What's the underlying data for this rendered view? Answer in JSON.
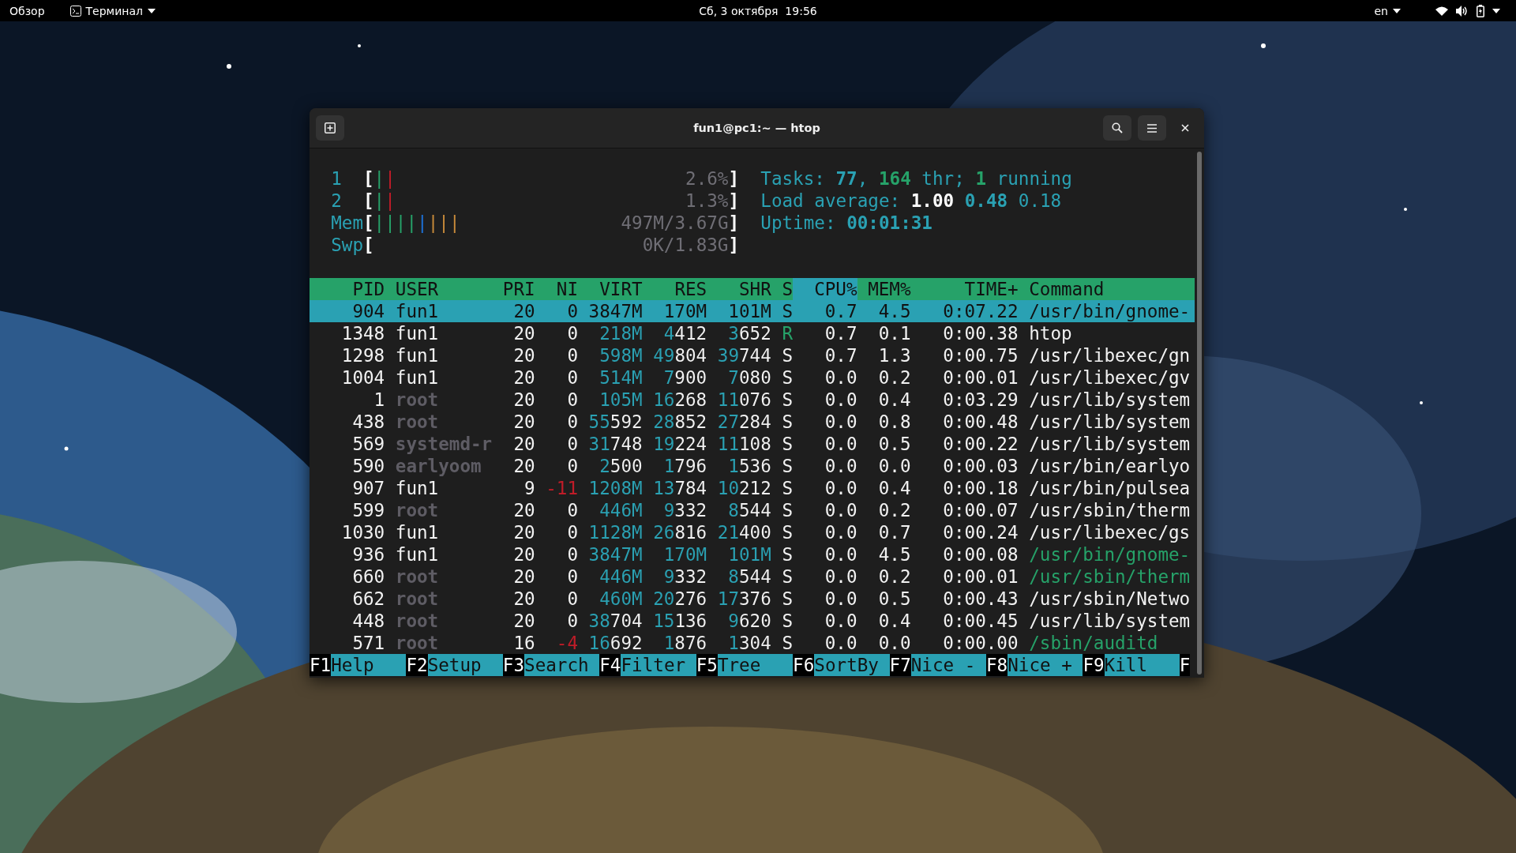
{
  "top_bar": {
    "activities": "Обзор",
    "app_menu": "Терминал",
    "clock": "Сб, 3 октября  19:56",
    "keyboard_layout": "en"
  },
  "window": {
    "title": "fun1@pc1:~ — htop"
  },
  "meters": [
    {
      "label": "1",
      "open": "[",
      "segments": [
        {
          "text": "|",
          "color": "#26a269"
        },
        {
          "text": "|",
          "color": "#c01c28"
        }
      ],
      "value": "2.6%",
      "close": "]"
    },
    {
      "label": "2",
      "open": "[",
      "segments": [
        {
          "text": "|",
          "color": "#26a269"
        },
        {
          "text": "|",
          "color": "#c01c28"
        }
      ],
      "value": "1.3%",
      "close": "]"
    },
    {
      "label": "Mem",
      "open": "[",
      "segments": [
        {
          "text": "|",
          "color": "#26a269"
        },
        {
          "text": "|",
          "color": "#26a269"
        },
        {
          "text": "|",
          "color": "#26a269"
        },
        {
          "text": "|",
          "color": "#26a269"
        },
        {
          "text": "|",
          "color": "#1c71d8"
        },
        {
          "text": "|",
          "color": "#c88a3a"
        },
        {
          "text": "|",
          "color": "#c88a3a"
        },
        {
          "text": "|",
          "color": "#c88a3a"
        }
      ],
      "value": "497M/3.67G",
      "close": "]"
    },
    {
      "label": "Swp",
      "open": "[",
      "value": "0K/1.83G",
      "close": "]"
    }
  ],
  "summary": [
    {
      "parts": [
        {
          "text": "Tasks: ",
          "kind": "label"
        },
        {
          "text": "77",
          "kind": "primary"
        },
        {
          "text": ", ",
          "kind": "label"
        },
        {
          "text": "164",
          "kind": "secondary"
        },
        {
          "text": " thr; ",
          "kind": "label"
        },
        {
          "text": "1",
          "kind": "secondary"
        },
        {
          "text": " running",
          "kind": "label"
        }
      ]
    },
    {
      "parts": [
        {
          "text": "Load average: ",
          "kind": "label"
        },
        {
          "text": "1.00",
          "kind": "accent"
        },
        {
          "text": " 0.48",
          "kind": "primary"
        },
        {
          "text": " 0.18",
          "kind": "label"
        }
      ]
    },
    {
      "parts": [
        {
          "text": "Uptime: ",
          "kind": "label"
        },
        {
          "text": "00:01:31",
          "kind": "primary"
        }
      ]
    }
  ],
  "columns": [
    {
      "label": "PID",
      "selected": false
    },
    {
      "label": "USER",
      "selected": false
    },
    {
      "label": "PRI",
      "selected": false
    },
    {
      "label": "NI",
      "selected": false
    },
    {
      "label": "VIRT",
      "selected": false
    },
    {
      "label": "RES",
      "selected": false
    },
    {
      "label": "SHR",
      "selected": false
    },
    {
      "label": "S",
      "selected": false
    },
    {
      "label": "CPU%",
      "selected": true
    },
    {
      "label": "MEM%",
      "selected": false
    },
    {
      "label": "TIME+",
      "selected": false
    },
    {
      "label": "Command",
      "selected": false
    }
  ],
  "rows": [
    {
      "pid": "904",
      "user": "fun1",
      "pri": "20",
      "ni": "0",
      "virt": "3847M",
      "res": "170M",
      "shr": "101M",
      "state": "S",
      "cpu": "0.7",
      "mem": "4.5",
      "time": "0:07.22",
      "command": "/usr/bin/gnome-",
      "selected": true,
      "system_user": false,
      "running": false,
      "thread": false
    },
    {
      "pid": "1348",
      "user": "fun1",
      "pri": "20",
      "ni": "0",
      "virt": "218M",
      "res": "4412",
      "shr": "3652",
      "state": "R",
      "cpu": "0.7",
      "mem": "0.1",
      "time": "0:00.38",
      "command": "htop",
      "selected": false,
      "system_user": false,
      "running": true,
      "thread": false
    },
    {
      "pid": "1298",
      "user": "fun1",
      "pri": "20",
      "ni": "0",
      "virt": "598M",
      "res": "49804",
      "shr": "39744",
      "state": "S",
      "cpu": "0.7",
      "mem": "1.3",
      "time": "0:00.75",
      "command": "/usr/libexec/gn",
      "selected": false,
      "system_user": false,
      "running": false,
      "thread": false
    },
    {
      "pid": "1004",
      "user": "fun1",
      "pri": "20",
      "ni": "0",
      "virt": "514M",
      "res": "7900",
      "shr": "7080",
      "state": "S",
      "cpu": "0.0",
      "mem": "0.2",
      "time": "0:00.01",
      "command": "/usr/libexec/gv",
      "selected": false,
      "system_user": false,
      "running": false,
      "thread": false
    },
    {
      "pid": "1",
      "user": "root",
      "pri": "20",
      "ni": "0",
      "virt": "105M",
      "res": "16268",
      "shr": "11076",
      "state": "S",
      "cpu": "0.0",
      "mem": "0.4",
      "time": "0:03.29",
      "command": "/usr/lib/system",
      "selected": false,
      "system_user": true,
      "running": false,
      "thread": false
    },
    {
      "pid": "438",
      "user": "root",
      "pri": "20",
      "ni": "0",
      "virt": "55592",
      "res": "28852",
      "shr": "27284",
      "state": "S",
      "cpu": "0.0",
      "mem": "0.8",
      "time": "0:00.48",
      "command": "/usr/lib/system",
      "selected": false,
      "system_user": true,
      "running": false,
      "thread": false
    },
    {
      "pid": "569",
      "user": "systemd-r",
      "pri": "20",
      "ni": "0",
      "virt": "31748",
      "res": "19224",
      "shr": "11108",
      "state": "S",
      "cpu": "0.0",
      "mem": "0.5",
      "time": "0:00.22",
      "command": "/usr/lib/system",
      "selected": false,
      "system_user": true,
      "running": false,
      "thread": false
    },
    {
      "pid": "590",
      "user": "earlyoom",
      "pri": "20",
      "ni": "0",
      "virt": "2500",
      "res": "1796",
      "shr": "1536",
      "state": "S",
      "cpu": "0.0",
      "mem": "0.0",
      "time": "0:00.03",
      "command": "/usr/bin/earlyo",
      "selected": false,
      "system_user": true,
      "running": false,
      "thread": false
    },
    {
      "pid": "907",
      "user": "fun1",
      "pri": "9",
      "ni": "-11",
      "virt": "1208M",
      "res": "13784",
      "shr": "10212",
      "state": "S",
      "cpu": "0.0",
      "mem": "0.4",
      "time": "0:00.18",
      "command": "/usr/bin/pulsea",
      "selected": false,
      "system_user": false,
      "running": false,
      "thread": false
    },
    {
      "pid": "599",
      "user": "root",
      "pri": "20",
      "ni": "0",
      "virt": "446M",
      "res": "9332",
      "shr": "8544",
      "state": "S",
      "cpu": "0.0",
      "mem": "0.2",
      "time": "0:00.07",
      "command": "/usr/sbin/therm",
      "selected": false,
      "system_user": true,
      "running": false,
      "thread": false
    },
    {
      "pid": "1030",
      "user": "fun1",
      "pri": "20",
      "ni": "0",
      "virt": "1128M",
      "res": "26816",
      "shr": "21400",
      "state": "S",
      "cpu": "0.0",
      "mem": "0.7",
      "time": "0:00.24",
      "command": "/usr/libexec/gs",
      "selected": false,
      "system_user": false,
      "running": false,
      "thread": false
    },
    {
      "pid": "936",
      "user": "fun1",
      "pri": "20",
      "ni": "0",
      "virt": "3847M",
      "res": "170M",
      "shr": "101M",
      "state": "S",
      "cpu": "0.0",
      "mem": "4.5",
      "time": "0:00.08",
      "command": "/usr/bin/gnome-",
      "selected": false,
      "system_user": false,
      "running": false,
      "thread": true
    },
    {
      "pid": "660",
      "user": "root",
      "pri": "20",
      "ni": "0",
      "virt": "446M",
      "res": "9332",
      "shr": "8544",
      "state": "S",
      "cpu": "0.0",
      "mem": "0.2",
      "time": "0:00.01",
      "command": "/usr/sbin/therm",
      "selected": false,
      "system_user": true,
      "running": false,
      "thread": true
    },
    {
      "pid": "662",
      "user": "root",
      "pri": "20",
      "ni": "0",
      "virt": "460M",
      "res": "20276",
      "shr": "17376",
      "state": "S",
      "cpu": "0.0",
      "mem": "0.5",
      "time": "0:00.43",
      "command": "/usr/sbin/Netwo",
      "selected": false,
      "system_user": true,
      "running": false,
      "thread": false
    },
    {
      "pid": "448",
      "user": "root",
      "pri": "20",
      "ni": "0",
      "virt": "38704",
      "res": "15136",
      "shr": "9620",
      "state": "S",
      "cpu": "0.0",
      "mem": "0.4",
      "time": "0:00.45",
      "command": "/usr/lib/system",
      "selected": false,
      "system_user": true,
      "running": false,
      "thread": false
    },
    {
      "pid": "571",
      "user": "root",
      "pri": "16",
      "ni": "-4",
      "virt": "16692",
      "res": "1876",
      "shr": "1304",
      "state": "S",
      "cpu": "0.0",
      "mem": "0.0",
      "time": "0:00.00",
      "command": "/sbin/auditd",
      "selected": false,
      "system_user": true,
      "running": false,
      "thread": true
    }
  ],
  "function_keys": [
    {
      "key": "F1",
      "label": "Help"
    },
    {
      "key": "F2",
      "label": "Setup"
    },
    {
      "key": "F3",
      "label": "Search"
    },
    {
      "key": "F4",
      "label": "Filter"
    },
    {
      "key": "F5",
      "label": "Tree"
    },
    {
      "key": "F6",
      "label": "SortBy"
    },
    {
      "key": "F7",
      "label": "Nice -"
    },
    {
      "key": "F8",
      "label": "Nice +"
    },
    {
      "key": "F9",
      "label": "Kill"
    },
    {
      "key": "F"
    }
  ]
}
